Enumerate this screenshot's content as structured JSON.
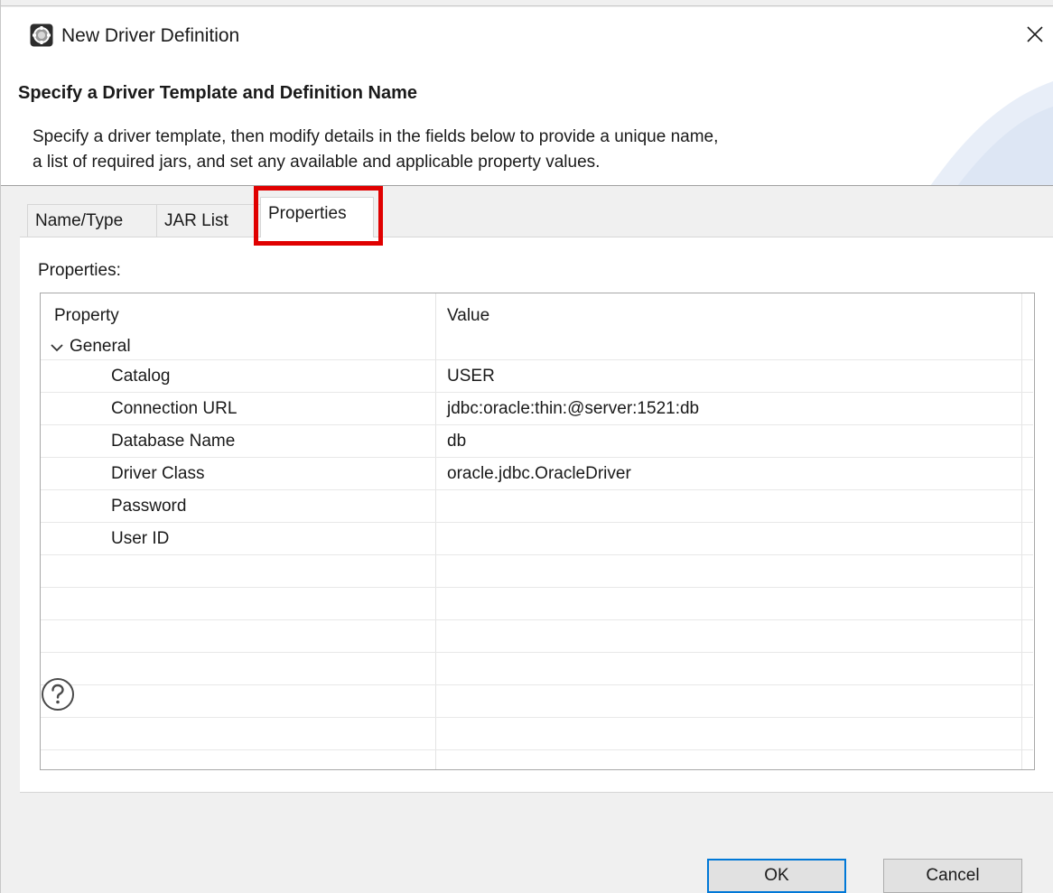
{
  "window": {
    "title": "New Driver Definition",
    "close_icon": "close-icon",
    "app_icon": "eclipse-gear-icon"
  },
  "header": {
    "title": "Specify a Driver Template and Definition Name",
    "description_line1": "Specify a driver template, then modify details in the fields below to provide a unique name,",
    "description_line2": "a list of required jars, and set any available and applicable property values."
  },
  "tabs": [
    {
      "label": "Name/Type",
      "active": false
    },
    {
      "label": "JAR List",
      "active": false
    },
    {
      "label": "Properties",
      "active": true,
      "highlighted": true
    }
  ],
  "properties_panel": {
    "label": "Properties:",
    "columns": [
      "Property",
      "Value"
    ],
    "group": {
      "label": "General",
      "expanded": true
    },
    "rows": [
      {
        "property": "Catalog",
        "value": "USER"
      },
      {
        "property": "Connection URL",
        "value": "jdbc:oracle:thin:@server:1521:db"
      },
      {
        "property": "Database Name",
        "value": "db"
      },
      {
        "property": "Driver Class",
        "value": "oracle.jdbc.OracleDriver"
      },
      {
        "property": "Password",
        "value": ""
      },
      {
        "property": "User ID",
        "value": ""
      }
    ]
  },
  "footer": {
    "help_icon": "help-icon",
    "ok_label": "OK",
    "cancel_label": "Cancel"
  },
  "colors": {
    "highlight": "#e00000",
    "default_button_border": "#0078d7"
  }
}
